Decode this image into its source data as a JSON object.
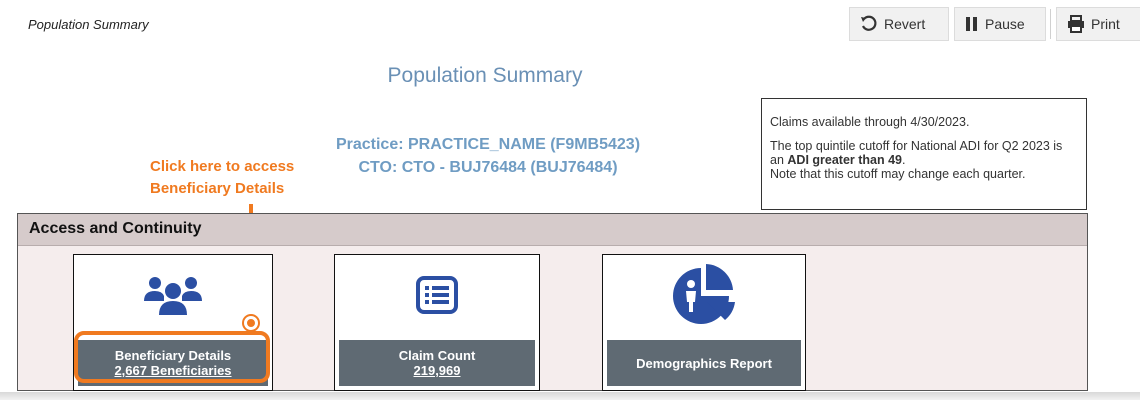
{
  "breadcrumb": "Population Summary",
  "toolbar": {
    "revert_label": "Revert",
    "pause_label": "Pause",
    "print_label": "Print"
  },
  "page_title": "Population Summary",
  "practice_line": "Practice: PRACTICE_NAME (F9MB5423)",
  "cto_line": "CTO: CTO - BUJ76484 (BUJ76484)",
  "callout": {
    "line1": "Click here to access",
    "line2": "Beneficiary Details",
    "color": "#f07a20"
  },
  "note": {
    "claims_text": "Claims available through 4/30/2023.",
    "adi_prefix": "The top quintile cutoff for National ADI for Q2 2023 is an ",
    "adi_bold": "ADI greater than 49",
    "adi_suffix": ".",
    "cutoff_text": "Note that this cutoff may change each quarter."
  },
  "section": {
    "title": "Access and Continuity"
  },
  "tiles": [
    {
      "icon": "users-icon",
      "title": "Beneficiary Details",
      "subtitle": "2,667 Beneficiaries"
    },
    {
      "icon": "list-icon",
      "title": "Claim Count",
      "subtitle": "219,969"
    },
    {
      "icon": "demographics-pie-icon",
      "title": "Demographics Report",
      "subtitle": ""
    }
  ],
  "colors": {
    "accent_blue": "#6f9cc3",
    "icon_blue": "#2b4fa3",
    "tile_caption_bg": "#5f6a73",
    "section_header_bg": "#d6cbcb"
  }
}
